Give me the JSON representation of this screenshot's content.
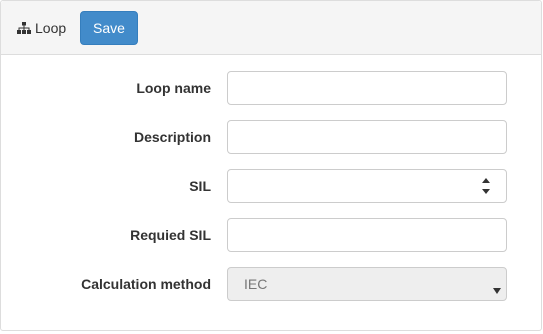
{
  "header": {
    "title": "Loop",
    "save_label": "Save"
  },
  "form": {
    "loop_name": {
      "label": "Loop name",
      "value": ""
    },
    "description": {
      "label": "Description",
      "value": ""
    },
    "sil": {
      "label": "SIL",
      "value": ""
    },
    "required_sil": {
      "label": "Requied SIL",
      "value": ""
    },
    "calculation_method": {
      "label": "Calculation method",
      "value": "IEC"
    }
  },
  "colors": {
    "primary": "#428bca",
    "heading_bg": "#f5f5f5",
    "disabled_bg": "#eeeeee"
  }
}
